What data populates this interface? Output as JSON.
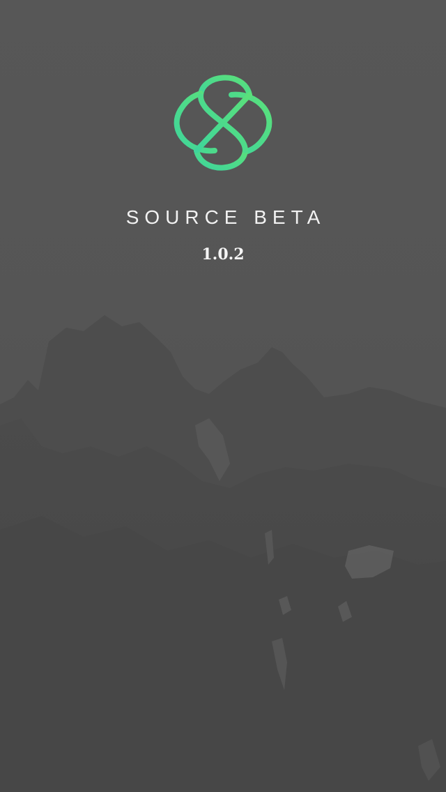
{
  "app": {
    "title": "SOURCE BETA",
    "version": "1.0.2"
  },
  "icons": {
    "logo": "source-infinity-knot-logo",
    "background": "mountain-landscape-image"
  },
  "colors": {
    "background": "#565656",
    "logo_gradient_start": "#3fd59b",
    "logo_gradient_end": "#5be07a",
    "text": "#f2f2f2"
  }
}
